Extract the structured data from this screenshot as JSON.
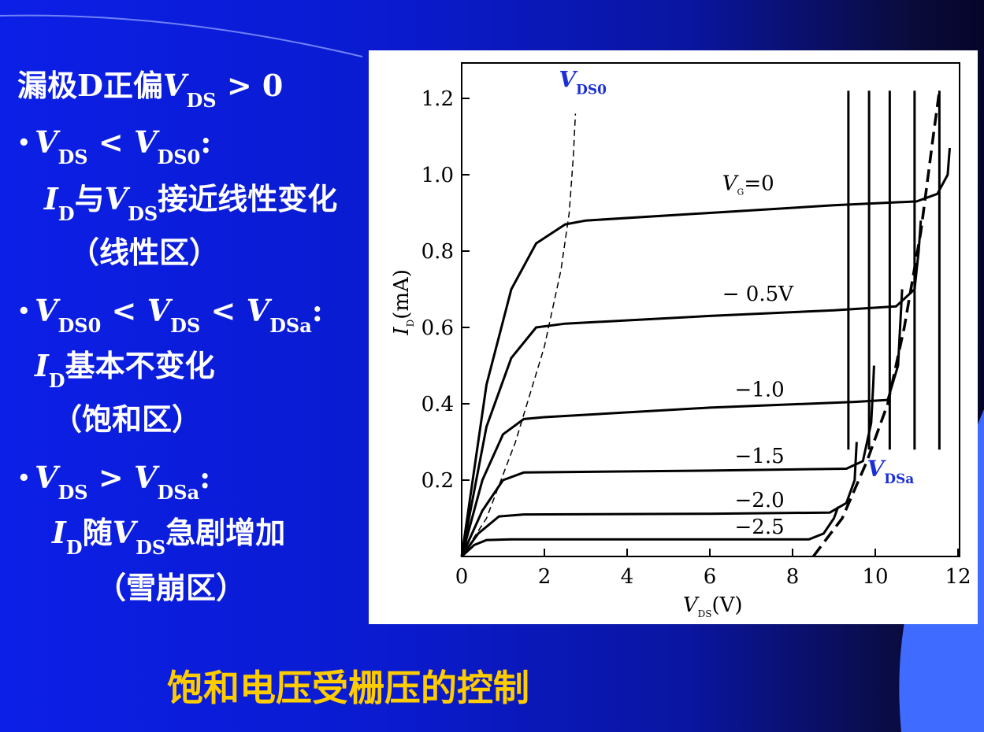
{
  "slide": {
    "heading": {
      "prefix": "漏极D正偏",
      "var": "V",
      "sub": "DS",
      "suffix": " > 0"
    },
    "items": [
      {
        "bullet": "•",
        "condition": {
          "v1": "V",
          "s1": "DS",
          "op": " < ",
          "v2": "V",
          "s2": "DS0",
          "tail": ":"
        },
        "description": {
          "v1": "I",
          "s1": "D",
          "mid": "与",
          "v2": "V",
          "s2": "DS",
          "tail": "接近线性变化"
        },
        "region": "（线性区）"
      },
      {
        "bullet": "•",
        "condition": {
          "v1": "V",
          "s1": "DS0",
          "op1": " < ",
          "v2": "V",
          "s2": "DS",
          "op2": " < ",
          "v3": "V",
          "s3": "DSa",
          "tail": ":"
        },
        "description": {
          "v1": "I",
          "s1": "D",
          "tail": "基本不变化"
        },
        "region": "（饱和区）"
      },
      {
        "bullet": "•",
        "condition": {
          "v1": "V",
          "s1": "DS",
          "op": " > ",
          "v2": "V",
          "s2": "DSa",
          "tail": ":"
        },
        "description": {
          "v1": "I",
          "s1": "D",
          "mid": "随",
          "v2": "V",
          "s2": "DS",
          "tail": "急剧增加"
        },
        "region": "（雪崩区）"
      }
    ],
    "footer_title": "饱和电压受栅压的控制"
  },
  "chart_data": {
    "type": "line",
    "xlabel": {
      "var": "V",
      "sub": "DS",
      "unit": "(V)"
    },
    "ylabel": {
      "var": "I",
      "sub": "D",
      "unit": "(mA)"
    },
    "xlim": [
      0,
      12
    ],
    "ylim": [
      0,
      1.3
    ],
    "xticks": [
      "0",
      "2",
      "4",
      "6",
      "8",
      "10",
      "12"
    ],
    "yticks": [
      "0.2",
      "0.4",
      "0.6",
      "0.8",
      "1.0",
      "1.2"
    ],
    "ytick_values": [
      0.2,
      0.4,
      0.6,
      0.8,
      1.0,
      1.2
    ],
    "series": [
      {
        "name": "VG=0",
        "label": {
          "pre": "V",
          "sub": "G",
          "post": "=0"
        },
        "label_at": [
          6.3,
          0.96
        ],
        "points": [
          [
            0,
            0
          ],
          [
            0.6,
            0.45
          ],
          [
            1.2,
            0.7
          ],
          [
            1.8,
            0.82
          ],
          [
            2.5,
            0.87
          ],
          [
            3,
            0.88
          ],
          [
            6,
            0.9
          ],
          [
            9,
            0.92
          ],
          [
            11,
            0.93
          ],
          [
            11.5,
            0.95
          ],
          [
            11.75,
            1.0
          ],
          [
            11.8,
            1.07
          ]
        ]
      },
      {
        "name": "-0.5V",
        "label": {
          "pre": "− 0.5V",
          "sub": "",
          "post": ""
        },
        "label_at": [
          6.3,
          0.67
        ],
        "points": [
          [
            0,
            0
          ],
          [
            0.6,
            0.34
          ],
          [
            1.2,
            0.52
          ],
          [
            1.8,
            0.6
          ],
          [
            2.5,
            0.61
          ],
          [
            6,
            0.63
          ],
          [
            9,
            0.645
          ],
          [
            10.5,
            0.655
          ],
          [
            10.95,
            0.7
          ],
          [
            11.05,
            0.8
          ],
          [
            11.1,
            0.88
          ]
        ]
      },
      {
        "name": "-1.0",
        "label": {
          "pre": "−1.0",
          "sub": "",
          "post": ""
        },
        "label_at": [
          6.6,
          0.42
        ],
        "points": [
          [
            0,
            0
          ],
          [
            0.5,
            0.2
          ],
          [
            1,
            0.32
          ],
          [
            1.5,
            0.36
          ],
          [
            2,
            0.365
          ],
          [
            6,
            0.39
          ],
          [
            9.5,
            0.405
          ],
          [
            10.3,
            0.41
          ],
          [
            10.55,
            0.5
          ],
          [
            10.6,
            0.6
          ],
          [
            10.65,
            0.7
          ]
        ]
      },
      {
        "name": "-1.5",
        "label": {
          "pre": "−1.5",
          "sub": "",
          "post": ""
        },
        "label_at": [
          6.6,
          0.245
        ],
        "points": [
          [
            0,
            0
          ],
          [
            0.5,
            0.12
          ],
          [
            1,
            0.2
          ],
          [
            1.5,
            0.22
          ],
          [
            6,
            0.225
          ],
          [
            9.3,
            0.23
          ],
          [
            9.7,
            0.25
          ],
          [
            9.9,
            0.35
          ],
          [
            9.95,
            0.45
          ],
          [
            9.97,
            0.5
          ]
        ]
      },
      {
        "name": "-2.0",
        "label": {
          "pre": "−2.0",
          "sub": "",
          "post": ""
        },
        "label_at": [
          6.6,
          0.13
        ],
        "points": [
          [
            0,
            0
          ],
          [
            0.4,
            0.06
          ],
          [
            0.9,
            0.105
          ],
          [
            1.5,
            0.11
          ],
          [
            6,
            0.112
          ],
          [
            8.9,
            0.115
          ],
          [
            9.3,
            0.14
          ],
          [
            9.5,
            0.2
          ],
          [
            9.55,
            0.3
          ]
        ]
      },
      {
        "name": "-2.5",
        "label": {
          "pre": "−2.5",
          "sub": "",
          "post": ""
        },
        "label_at": [
          6.6,
          0.06
        ],
        "points": [
          [
            0,
            0
          ],
          [
            0.3,
            0.03
          ],
          [
            0.6,
            0.043
          ],
          [
            1.2,
            0.045
          ],
          [
            6,
            0.045
          ],
          [
            8.4,
            0.045
          ],
          [
            8.75,
            0.06
          ],
          [
            9.0,
            0.1
          ],
          [
            9.1,
            0.13
          ]
        ]
      }
    ],
    "vertical_lines_x": [
      9.35,
      9.85,
      10.35,
      10.95,
      11.55
    ],
    "vertical_lines_top": 1.22,
    "vds0_curve": {
      "label": {
        "var": "V",
        "sub": "DS0"
      },
      "label_at": [
        2.35,
        1.23
      ],
      "points": [
        [
          0,
          0
        ],
        [
          0.6,
          0.1
        ],
        [
          1.3,
          0.3
        ],
        [
          2,
          0.55
        ],
        [
          2.4,
          0.75
        ],
        [
          2.6,
          0.9
        ],
        [
          2.7,
          1.05
        ],
        [
          2.75,
          1.16
        ]
      ]
    },
    "vdsa_curve": {
      "label": {
        "var": "V",
        "sub": "DSa"
      },
      "label_at": [
        9.8,
        0.21
      ],
      "points": [
        [
          8.5,
          0
        ],
        [
          9.2,
          0.1
        ],
        [
          9.8,
          0.25
        ],
        [
          10.3,
          0.4
        ],
        [
          10.7,
          0.6
        ],
        [
          11.1,
          0.85
        ],
        [
          11.4,
          1.1
        ],
        [
          11.55,
          1.22
        ]
      ]
    }
  }
}
